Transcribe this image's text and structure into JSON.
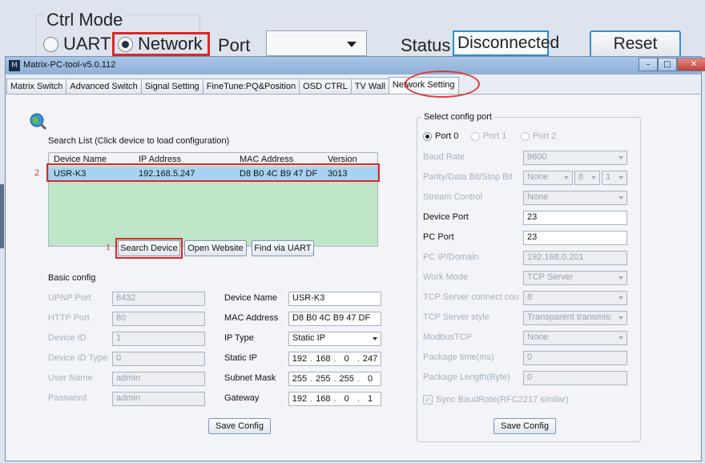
{
  "outer": {
    "ctrl_mode_title": "Ctrl Mode",
    "radio_uart": "UART",
    "radio_network": "Network",
    "port_label": "Port",
    "port_value": "",
    "status_label": "Status",
    "status_value": "Disconnected",
    "reset_label": "Reset"
  },
  "window": {
    "title": "Matrix-PC-tool-v5.0.112",
    "icon_text": "M",
    "controls": [
      "–",
      "□",
      "✕"
    ]
  },
  "tabs": [
    "Matrix Switch",
    "Advanced Switch",
    "Signal Setting",
    "FineTune:PQ&Position",
    "OSD CTRL",
    "TV Wall",
    "Network Setting"
  ],
  "search": {
    "title": "Search List (Click device to load configuration)",
    "columns": [
      "Device Name",
      "IP Address",
      "MAC Address",
      "Version"
    ],
    "rows": [
      {
        "name": "USR-K3",
        "ip": "192.168.5.247",
        "mac": "D8 B0 4C B9 47 DF",
        "version": "3013"
      }
    ],
    "row_marker": "2",
    "search_marker": "1",
    "buttons": {
      "search": "Search Device",
      "website": "Open Website",
      "uart": "Find via UART"
    }
  },
  "basic": {
    "title": "Basic config",
    "upnp_label": "UPNP Port",
    "upnp_value": "6432",
    "http_label": "HTTP Port",
    "http_value": "80",
    "devid_label": "Device ID",
    "devid_value": "1",
    "devtype_label": "Device ID Type",
    "devtype_value": "0",
    "user_label": "User Name",
    "user_value": "admin",
    "pass_label": "Password",
    "pass_value": "admin",
    "devname_label": "Device Name",
    "devname_value": "USR-K3",
    "mac_label": "MAC Address",
    "mac_value": "D8 B0 4C B9 47 DF",
    "iptype_label": "IP Type",
    "iptype_value": "Static IP",
    "staticip_label": "Static IP",
    "staticip": [
      "192",
      "168",
      "0",
      "247"
    ],
    "subnet_label": "Subnet Mask",
    "subnet": [
      "255",
      "255",
      "255",
      "0"
    ],
    "gateway_label": "Gateway",
    "gateway": [
      "192",
      "168",
      "0",
      "1"
    ],
    "save_label": "Save Config"
  },
  "port": {
    "title": "Select config port",
    "port0": "Port 0",
    "port1": "Port 1",
    "port2": "Port 2",
    "baud_label": "Baud Rate",
    "baud_value": "9600",
    "parity_label": "Parity/Data Bit/Stop Bit",
    "parity_value": "None",
    "databits_value": "8",
    "stopbit_value": "1",
    "stream_label": "Stream Control",
    "stream_value": "None",
    "devport_label": "Device Port",
    "devport_value": "23",
    "pcport_label": "PC Port",
    "pcport_value": "23",
    "pcip_label": "PC IP/Domain",
    "pcip_value": "192.168.0.201",
    "workmode_label": "Work Mode",
    "workmode_value": "TCP Server",
    "tcpconn_label": "TCP Server connect cou",
    "tcpconn_value": "8",
    "tcpstyle_label": "TCP Server style",
    "tcpstyle_value": "Transparent transmis:",
    "modbus_label": "ModbusTCP",
    "modbus_value": "None",
    "pkgtime_label": "Package time(ms)",
    "pkgtime_value": "0",
    "pkglen_label": "Package Length(Byte)",
    "pkglen_value": "0",
    "sync_label": "Sync BaudRate(RFC2217 similar)",
    "save_label": "Save Config"
  }
}
